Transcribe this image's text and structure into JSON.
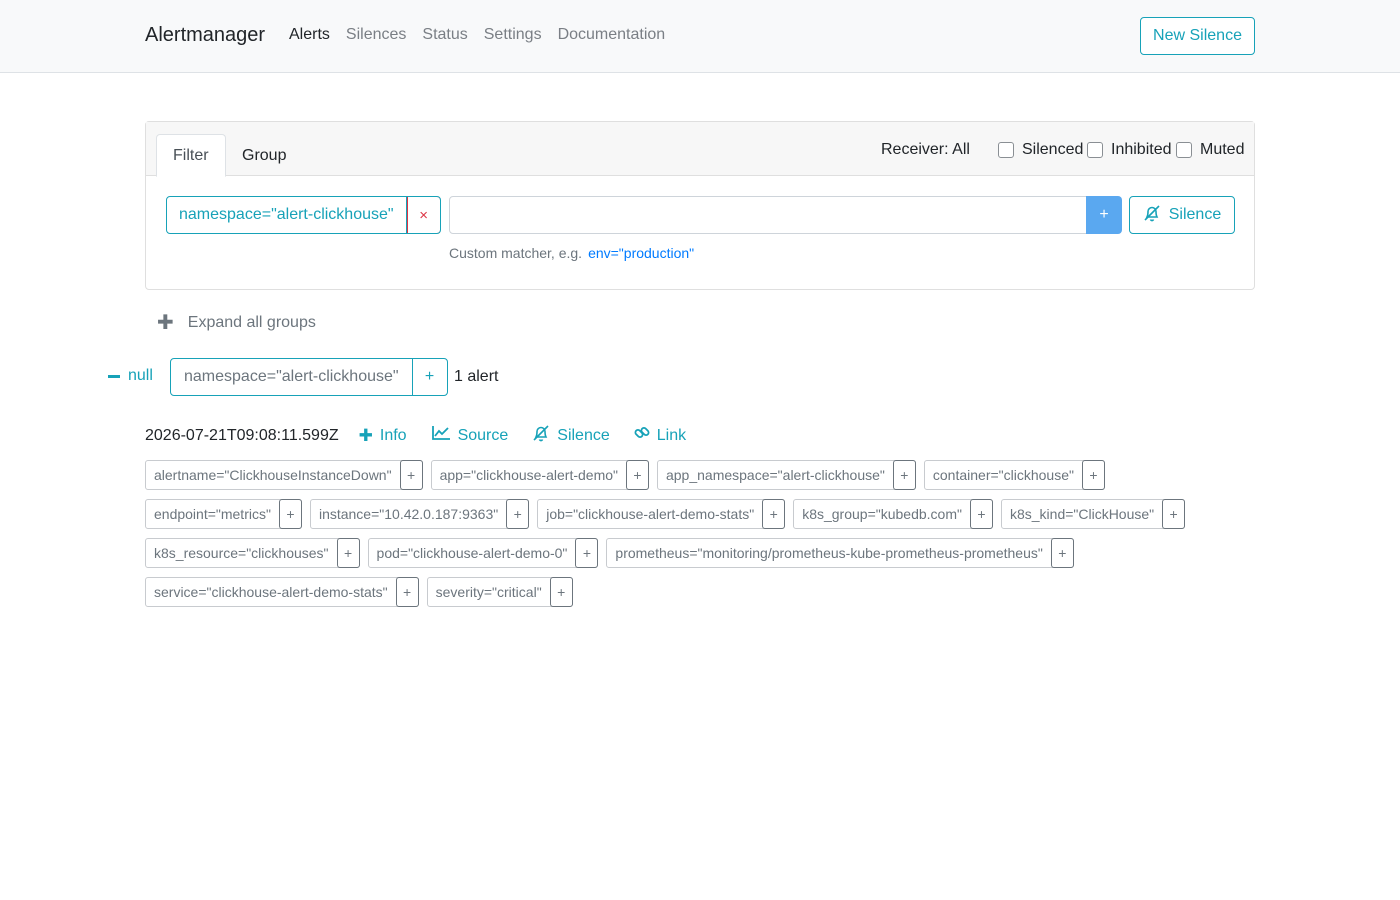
{
  "navbar": {
    "brand": "Alertmanager",
    "links": [
      {
        "label": "Alerts"
      },
      {
        "label": "Silences"
      },
      {
        "label": "Status"
      },
      {
        "label": "Settings"
      },
      {
        "label": "Documentation"
      }
    ],
    "new_silence_label": "New Silence"
  },
  "filter": {
    "tabs": [
      "Filter",
      "Group"
    ],
    "receiver_label": "Receiver: All",
    "checkboxes": [
      "Silenced",
      "Inhibited",
      "Muted"
    ],
    "active_matcher": "namespace=\"alert-clickhouse\"",
    "remove_symbol": "×",
    "add_symbol": "+",
    "silence_label": "Silence",
    "hint_text": "Custom matcher, e.g.",
    "hint_example": "env=\"production\""
  },
  "expand_all_label": "Expand all groups",
  "group": {
    "receiver": "null",
    "matcher": "namespace=\"alert-clickhouse\"",
    "add_symbol": "+",
    "count": "1 alert"
  },
  "alert": {
    "timestamp": "2026-07-21T09:08:11.599Z",
    "actions": {
      "info": "Info",
      "source": "Source",
      "silence": "Silence",
      "link": "Link"
    },
    "labels": [
      "alertname=\"ClickhouseInstanceDown\"",
      "app=\"clickhouse-alert-demo\"",
      "app_namespace=\"alert-clickhouse\"",
      "container=\"clickhouse\"",
      "endpoint=\"metrics\"",
      "instance=\"10.42.0.187:9363\"",
      "job=\"clickhouse-alert-demo-stats\"",
      "k8s_group=\"kubedb.com\"",
      "k8s_kind=\"ClickHouse\"",
      "k8s_resource=\"clickhouses\"",
      "pod=\"clickhouse-alert-demo-0\"",
      "prometheus=\"monitoring/prometheus-kube-prometheus-prometheus\"",
      "service=\"clickhouse-alert-demo-stats\"",
      "severity=\"critical\""
    ],
    "label_add_symbol": "+"
  }
}
